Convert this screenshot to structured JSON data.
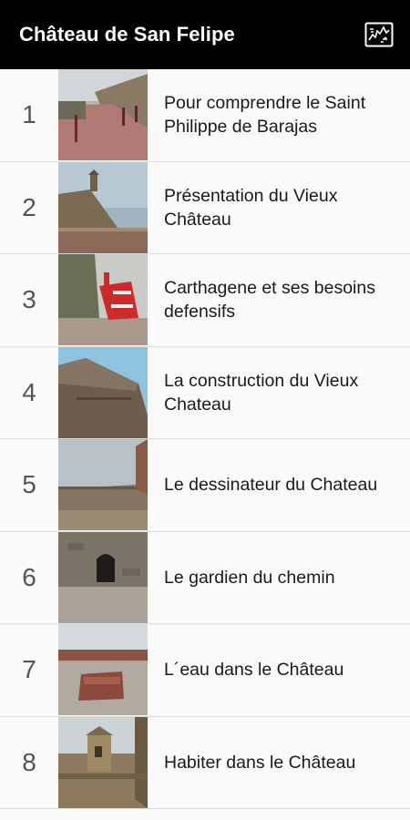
{
  "app_bar": {
    "title": "Château de San Felipe",
    "map_icon": "map-icon"
  },
  "items": [
    {
      "number": "1",
      "title": "Pour comprendre le Saint Philippe de Barajas"
    },
    {
      "number": "2",
      "title": "Présentation du Vieux Château"
    },
    {
      "number": "3",
      "title": "Carthagene et ses besoins defensifs"
    },
    {
      "number": "4",
      "title": "La construction du Vieux Chateau"
    },
    {
      "number": "5",
      "title": "Le dessinateur du Chateau"
    },
    {
      "number": "6",
      "title": "Le gardien du chemin"
    },
    {
      "number": "7",
      "title": "L´eau dans le Château"
    },
    {
      "number": "8",
      "title": "Habiter dans le Château"
    }
  ],
  "colors": {
    "app_bar_bg": "#000000",
    "app_bar_text": "#ffffff",
    "list_bg": "#fafafa",
    "divider": "#dcdcdc"
  }
}
